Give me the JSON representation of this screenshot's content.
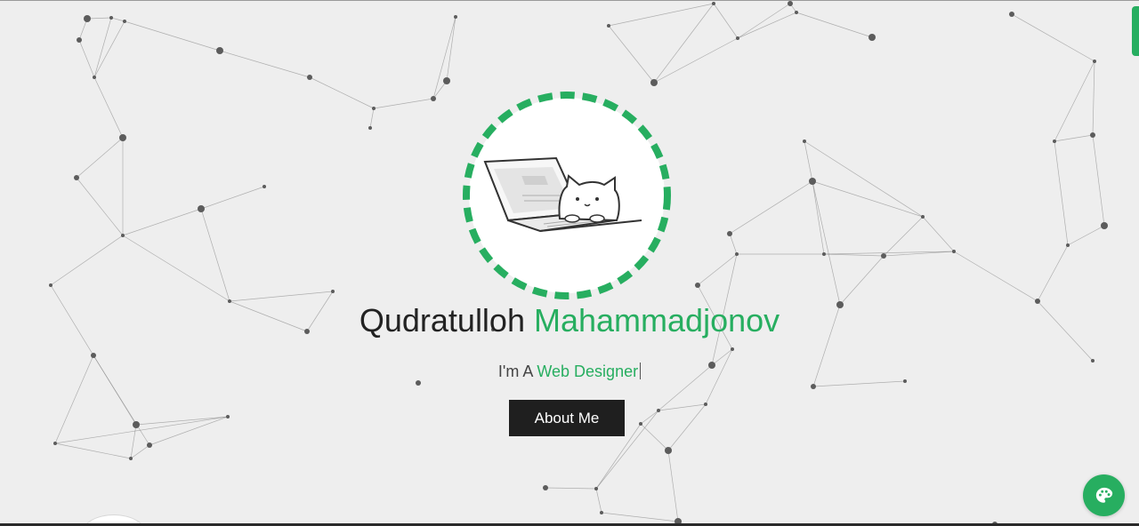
{
  "hero": {
    "first_name": "Qudratulloh",
    "last_name": "Mahammadjonov",
    "tagline_prefix": "I'm A",
    "tagline_role": "Web Designer",
    "about_button_label": "About Me"
  },
  "colors": {
    "accent": "#27ae60",
    "background": "#eeeeee",
    "button_background": "#1f1f1f",
    "text_dark": "#222222"
  },
  "icons": {
    "theme_toggle": "palette-icon",
    "avatar": "cat-on-laptop-illustration"
  }
}
